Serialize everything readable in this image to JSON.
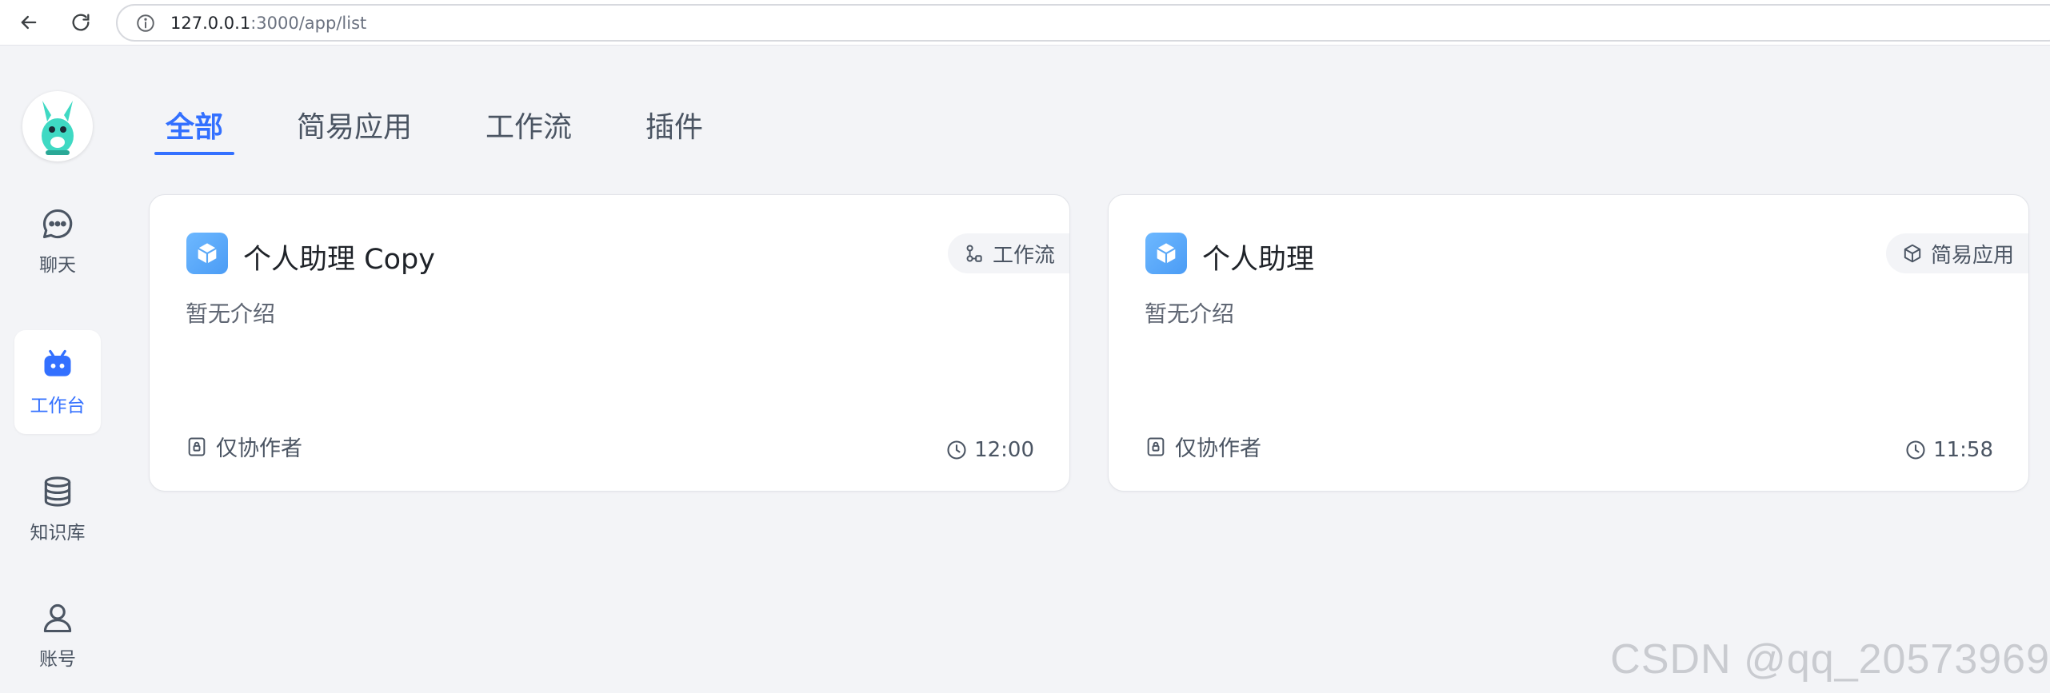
{
  "browser": {
    "url_host": "127.0.0.1",
    "url_path": ":3000/app/list"
  },
  "sidebar": {
    "items": [
      {
        "label": "聊天",
        "icon": "chat-icon",
        "active": false
      },
      {
        "label": "工作台",
        "icon": "robot-icon",
        "active": true
      },
      {
        "label": "知识库",
        "icon": "database-icon",
        "active": false
      },
      {
        "label": "账号",
        "icon": "user-icon",
        "active": false
      }
    ]
  },
  "tabs": [
    {
      "label": "全部",
      "active": true
    },
    {
      "label": "简易应用",
      "active": false
    },
    {
      "label": "工作流",
      "active": false
    },
    {
      "label": "插件",
      "active": false
    }
  ],
  "apps": [
    {
      "title": "个人助理 Copy",
      "badge": "工作流",
      "badge_icon": "workflow-icon",
      "description": "暂无介绍",
      "permission": "仅协作者",
      "time": "12:00"
    },
    {
      "title": "个人助理",
      "badge": "简易应用",
      "badge_icon": "cube-icon",
      "description": "暂无介绍",
      "permission": "仅协作者",
      "time": "11:58"
    }
  ],
  "watermark": "CSDN @qq_20573969",
  "colors": {
    "accent": "#3370ff",
    "background": "#f3f4f7",
    "card": "#ffffff"
  }
}
